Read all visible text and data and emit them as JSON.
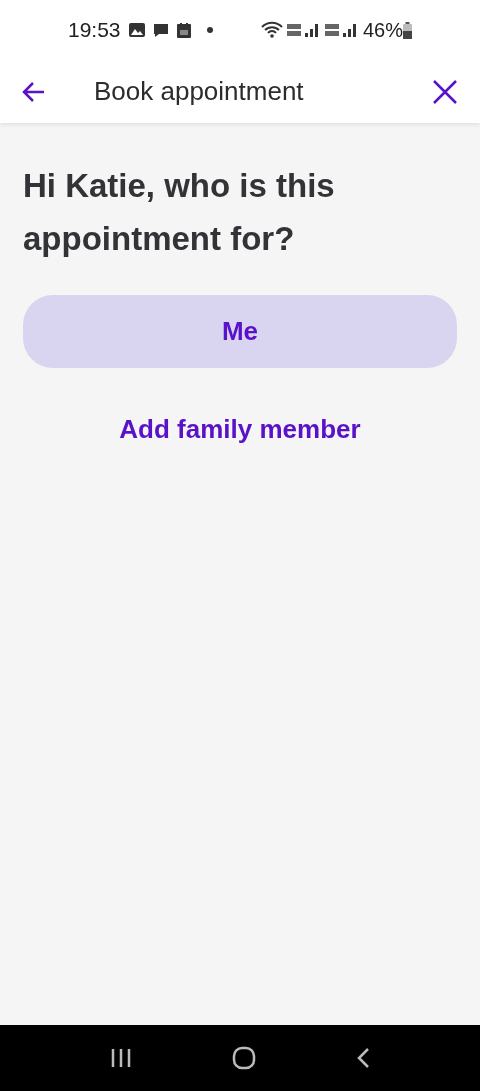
{
  "status_bar": {
    "time": "19:53",
    "battery": "46%"
  },
  "header": {
    "title": "Book appointment"
  },
  "question": "Hi Katie, who is this appointment for?",
  "options": [
    {
      "label": "Me",
      "kind": "filled"
    },
    {
      "label": "Add family member",
      "kind": "link"
    }
  ]
}
